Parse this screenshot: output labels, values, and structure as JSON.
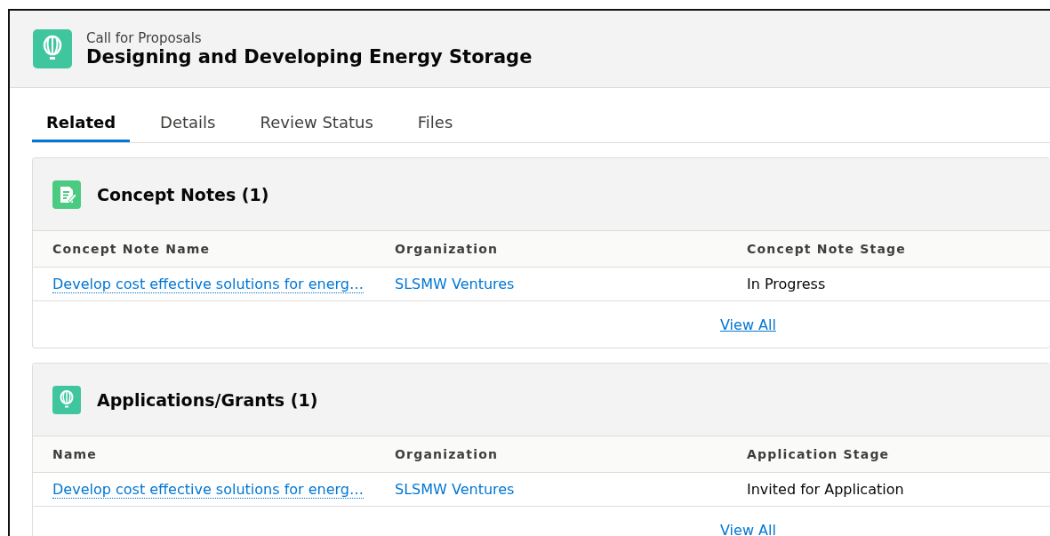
{
  "record_header": {
    "object_type": "Call for Proposals",
    "title": "Designing and Developing Energy Storage"
  },
  "tabs": [
    {
      "label": "Related",
      "selected": true
    },
    {
      "label": "Details",
      "selected": false
    },
    {
      "label": "Review Status",
      "selected": false
    },
    {
      "label": "Files",
      "selected": false
    }
  ],
  "related_lists": [
    {
      "title": "Concept Notes (1)",
      "columns": [
        "Concept Note Name",
        "Organization",
        "Concept Note Stage"
      ],
      "rows": [
        [
          "Develop cost effective solutions for energ…",
          "SLSMW Ventures",
          "In Progress"
        ]
      ],
      "view_all": "View All"
    },
    {
      "title": "Applications/Grants (1)",
      "columns": [
        "Name",
        "Organization",
        "Application Stage"
      ],
      "rows": [
        [
          "Develop cost effective solutions for energ…",
          "SLSMW Ventures",
          "Invited for Application"
        ]
      ],
      "view_all": "View All"
    }
  ]
}
